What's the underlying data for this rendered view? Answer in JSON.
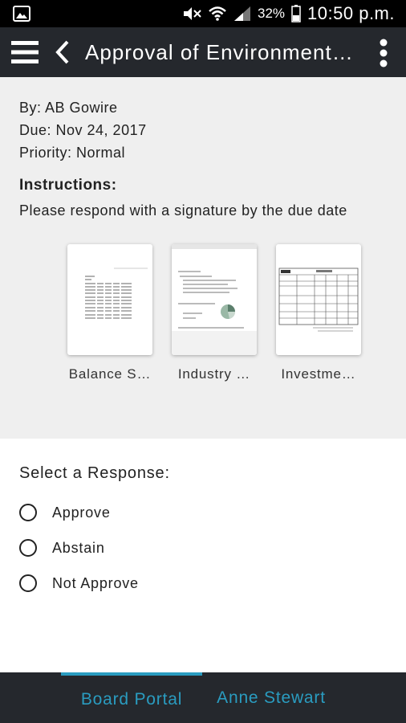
{
  "status_bar": {
    "battery_percent": "32%",
    "time": "10:50 p.m."
  },
  "app_bar": {
    "title": "Approval of Environment…"
  },
  "details": {
    "by": "By: AB Gowire",
    "due": "Due: Nov 24, 2017",
    "priority": "Priority: Normal"
  },
  "instructions": {
    "heading": "Instructions:",
    "text": "Please respond with a signature by the due date"
  },
  "documents": [
    {
      "label": "Balance S…",
      "icon": "spreadsheet-thumbnail"
    },
    {
      "label": "Industry …",
      "icon": "report-thumbnail"
    },
    {
      "label": "Investme…",
      "icon": "form-thumbnail"
    }
  ],
  "response": {
    "heading": "Select a Response:",
    "options": [
      "Approve",
      "Abstain",
      "Not Approve"
    ]
  },
  "bottom_nav": {
    "tabs": [
      "Board Portal",
      "Anne Stewart"
    ],
    "active_tab": "Board Portal"
  },
  "colors": {
    "accent": "#2a9cc0",
    "bar_bg": "#25282d",
    "info_bg": "#efefef"
  }
}
